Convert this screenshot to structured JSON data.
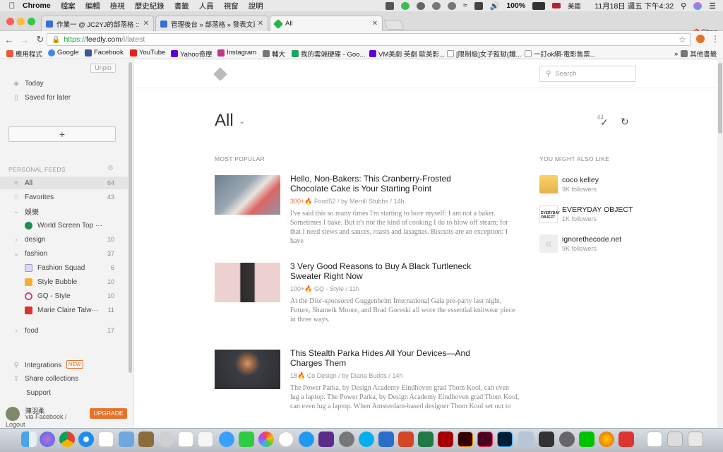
{
  "mac_menubar": {
    "app_name": "Chrome",
    "menus": [
      "檔案",
      "編輯",
      "檢視",
      "歷史紀錄",
      "書籤",
      "人員",
      "視窗",
      "說明"
    ],
    "status": {
      "battery": "100%",
      "input_lang": "美國",
      "datetime": "11月18日 週五 下午4:32"
    }
  },
  "tabs": [
    {
      "title": "作業一 @ JC2YJ的部落格 :: 痞客",
      "favicon_color": "#3b6fd4",
      "active": false
    },
    {
      "title": "管理後台 » 部落格 » 發表文章",
      "favicon_color": "#3b6fd4",
      "active": false
    },
    {
      "title": "All",
      "favicon_color": "#2bb24c",
      "active": true
    }
  ],
  "browser": {
    "profile_name": "Chen",
    "url_scheme": "https://",
    "url_host": "feedly.com",
    "url_path": "/i/latest"
  },
  "bookmarks": [
    {
      "label": "應用程式",
      "icon": "apps-grid-icon",
      "color": "#e45b3d"
    },
    {
      "label": "Google",
      "icon": "google-icon",
      "color": "#4285f4"
    },
    {
      "label": "Facebook",
      "icon": "facebook-icon",
      "color": "#3b5998"
    },
    {
      "label": "YouTube",
      "icon": "youtube-icon",
      "color": "#e62117"
    },
    {
      "label": "Yahoo奇摩",
      "icon": "yahoo-icon",
      "color": "#5f01d1"
    },
    {
      "label": "Instagram",
      "icon": "instagram-icon",
      "color": "#c13584"
    },
    {
      "label": "輔大",
      "icon": "folder-icon",
      "color": "#777777"
    },
    {
      "label": "我的雲端硬碟 - Goo...",
      "icon": "google-drive-icon",
      "color": "#1da462"
    },
    {
      "label": "VM美劇 英劇 歐美影...",
      "icon": "yahoo-icon",
      "color": "#5f01d1"
    },
    {
      "label": "[限制級]女子監獄(鐵...",
      "icon": "page-icon",
      "color": "#999999"
    },
    {
      "label": "一訂ok網-電影售票...",
      "icon": "page-icon",
      "color": "#999999"
    }
  ],
  "bookmarks_other": "其他書籤",
  "sidebar": {
    "unpin_label": "Unpin",
    "today_label": "Today",
    "saved_label": "Saved for later",
    "add_label": "+",
    "section_personal": "PERSONAL FEEDS",
    "feeds": [
      {
        "label": "All",
        "count": "64",
        "selected": true,
        "icon": "list-icon"
      },
      {
        "label": "Favorites",
        "count": "43",
        "selected": false,
        "icon": "star-icon"
      },
      {
        "label": "娛樂",
        "count": "",
        "selected": false,
        "icon": "chevron-down-icon"
      },
      {
        "label": "World Screen Top ···",
        "count": "",
        "selected": false,
        "sub": true,
        "favcolor": "#1f8f4e"
      },
      {
        "label": "design",
        "count": "10",
        "selected": false,
        "icon": "chevron-right-icon"
      },
      {
        "label": "fashion",
        "count": "37",
        "selected": false,
        "icon": "chevron-down-icon"
      },
      {
        "label": "Fashion Squad",
        "count": "6",
        "selected": false,
        "sub": true,
        "favcolor": "#d9d9f5"
      },
      {
        "label": "Style Bubble",
        "count": "10",
        "selected": false,
        "sub": true,
        "favcolor": "#f2b134"
      },
      {
        "label": "GQ - Style",
        "count": "10",
        "selected": false,
        "sub": true,
        "favcolor": "#e03a7e"
      },
      {
        "label": "Marie Claire Talw···",
        "count": "11",
        "selected": false,
        "sub": true,
        "favcolor": "#d9342b"
      },
      {
        "label": "food",
        "count": "17",
        "selected": false,
        "icon": "chevron-right-icon"
      }
    ],
    "integrations_label": "Integrations",
    "new_badge": "NEW",
    "share_label": "Share collections",
    "support_label": "Support",
    "user_name": "陳羽柔",
    "user_via": "via Facebook /",
    "logout_label": "Logout",
    "upgrade_label": "UPGRADE"
  },
  "main": {
    "search_placeholder": "Search",
    "page_title": "All",
    "unread_count": "64",
    "most_popular_label": "MOST POPULAR",
    "you_might_label": "YOU MIGHT ALSO LIKE",
    "articles": [
      {
        "title": "Hello, Non-Bakers: This Cranberry-Frosted Chocolate Cake is Your Starting Point",
        "popularity": "300+",
        "meta": "Food52 / by Merrill Stubbs / 14h",
        "snippet": "I've said this so many times I'm starting to bore myself: I am not a baker. Sometimes I bake. But it's not the kind of cooking I do to blow off steam; for that I need stews and sauces, roasts and lasagnas. Biscuits are an exception: I have",
        "thumb_color": "#8a98a6"
      },
      {
        "title": "3 Very Good Reasons to Buy A Black Turtleneck Sweater Right Now",
        "popularity": "100+",
        "meta": "GQ - Style / 11h",
        "snippet": "At the Dior-sponsored Guggenheim International Gala pre-party last night, Future, Shameik Moore, and Brad Goreski all wore the essential knitwear piece in three ways.",
        "thumb_color": "#e9c7c7"
      },
      {
        "title": "This Stealth Parka Hides All Your Devices—And Charges Them",
        "popularity": "18",
        "meta": "Co.Design / by Diana Budds / 14h",
        "snippet": "The Power Parka, by Design Academy Eindhoven grad Thom Kool, can even lug a laptop. The Power Parka, by Design Academy Eindhoven grad Thom Kool, can even lug a laptop. When Amsterdam-based designer Thom Kool set out to",
        "thumb_color": "#3a3d42"
      }
    ],
    "suggestions": [
      {
        "name": "coco kelley",
        "followers": "9K followers",
        "thumb_color": "#e8b04a"
      },
      {
        "name": "EVERYDAY OBJECT",
        "followers": "1K followers",
        "thumb_color": "#222222"
      },
      {
        "name": "ignorethecode.net",
        "followers": "9K followers",
        "thumb_color": "#dddddd"
      }
    ]
  }
}
